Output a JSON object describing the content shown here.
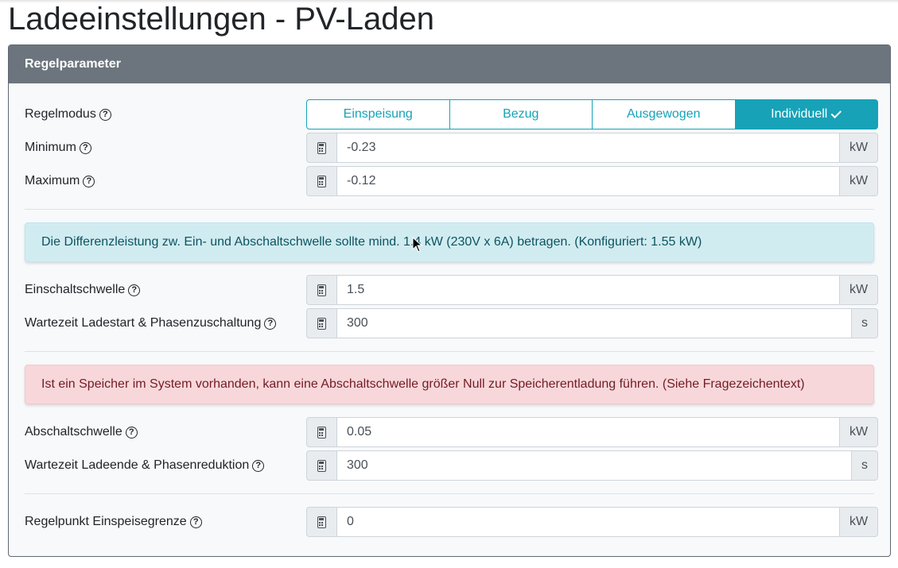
{
  "page": {
    "title": "Ladeeinstellungen - PV-Laden"
  },
  "card": {
    "header": "Regelparameter"
  },
  "regelmodus": {
    "label": "Regelmodus",
    "options": [
      "Einspeisung",
      "Bezug",
      "Ausgewogen",
      "Individuell"
    ],
    "selected": "Individuell"
  },
  "minimum": {
    "label": "Minimum",
    "value": "-0.23",
    "unit": "kW"
  },
  "maximum": {
    "label": "Maximum",
    "value": "-0.12",
    "unit": "kW"
  },
  "info_alert": "Die Differenzleistung zw. Ein- und Abschaltschwelle sollte mind. 1.4 kW (230V x 6A) betragen. (Konfiguriert: 1.55 kW)",
  "einschaltschwelle": {
    "label": "Einschaltschwelle",
    "value": "1.5",
    "unit": "kW"
  },
  "wartezeit_start": {
    "label": "Wartezeit Ladestart & Phasenzuschaltung",
    "value": "300",
    "unit": "s"
  },
  "danger_alert": "Ist ein Speicher im System vorhanden, kann eine Abschaltschwelle größer Null zur Speicherentladung führen. (Siehe Fragezeichentext)",
  "abschaltschwelle": {
    "label": "Abschaltschwelle",
    "value": "0.05",
    "unit": "kW"
  },
  "wartezeit_ende": {
    "label": "Wartezeit Ladeende & Phasenreduktion",
    "value": "300",
    "unit": "s"
  },
  "regelpunkt": {
    "label": "Regelpunkt Einspeisegrenze",
    "value": "0",
    "unit": "kW"
  },
  "icons": {
    "help": "question-circle-icon",
    "calculator": "calculator-icon",
    "check": "check-icon"
  },
  "colors": {
    "accent": "#17a2b8",
    "header": "#6c757d"
  }
}
